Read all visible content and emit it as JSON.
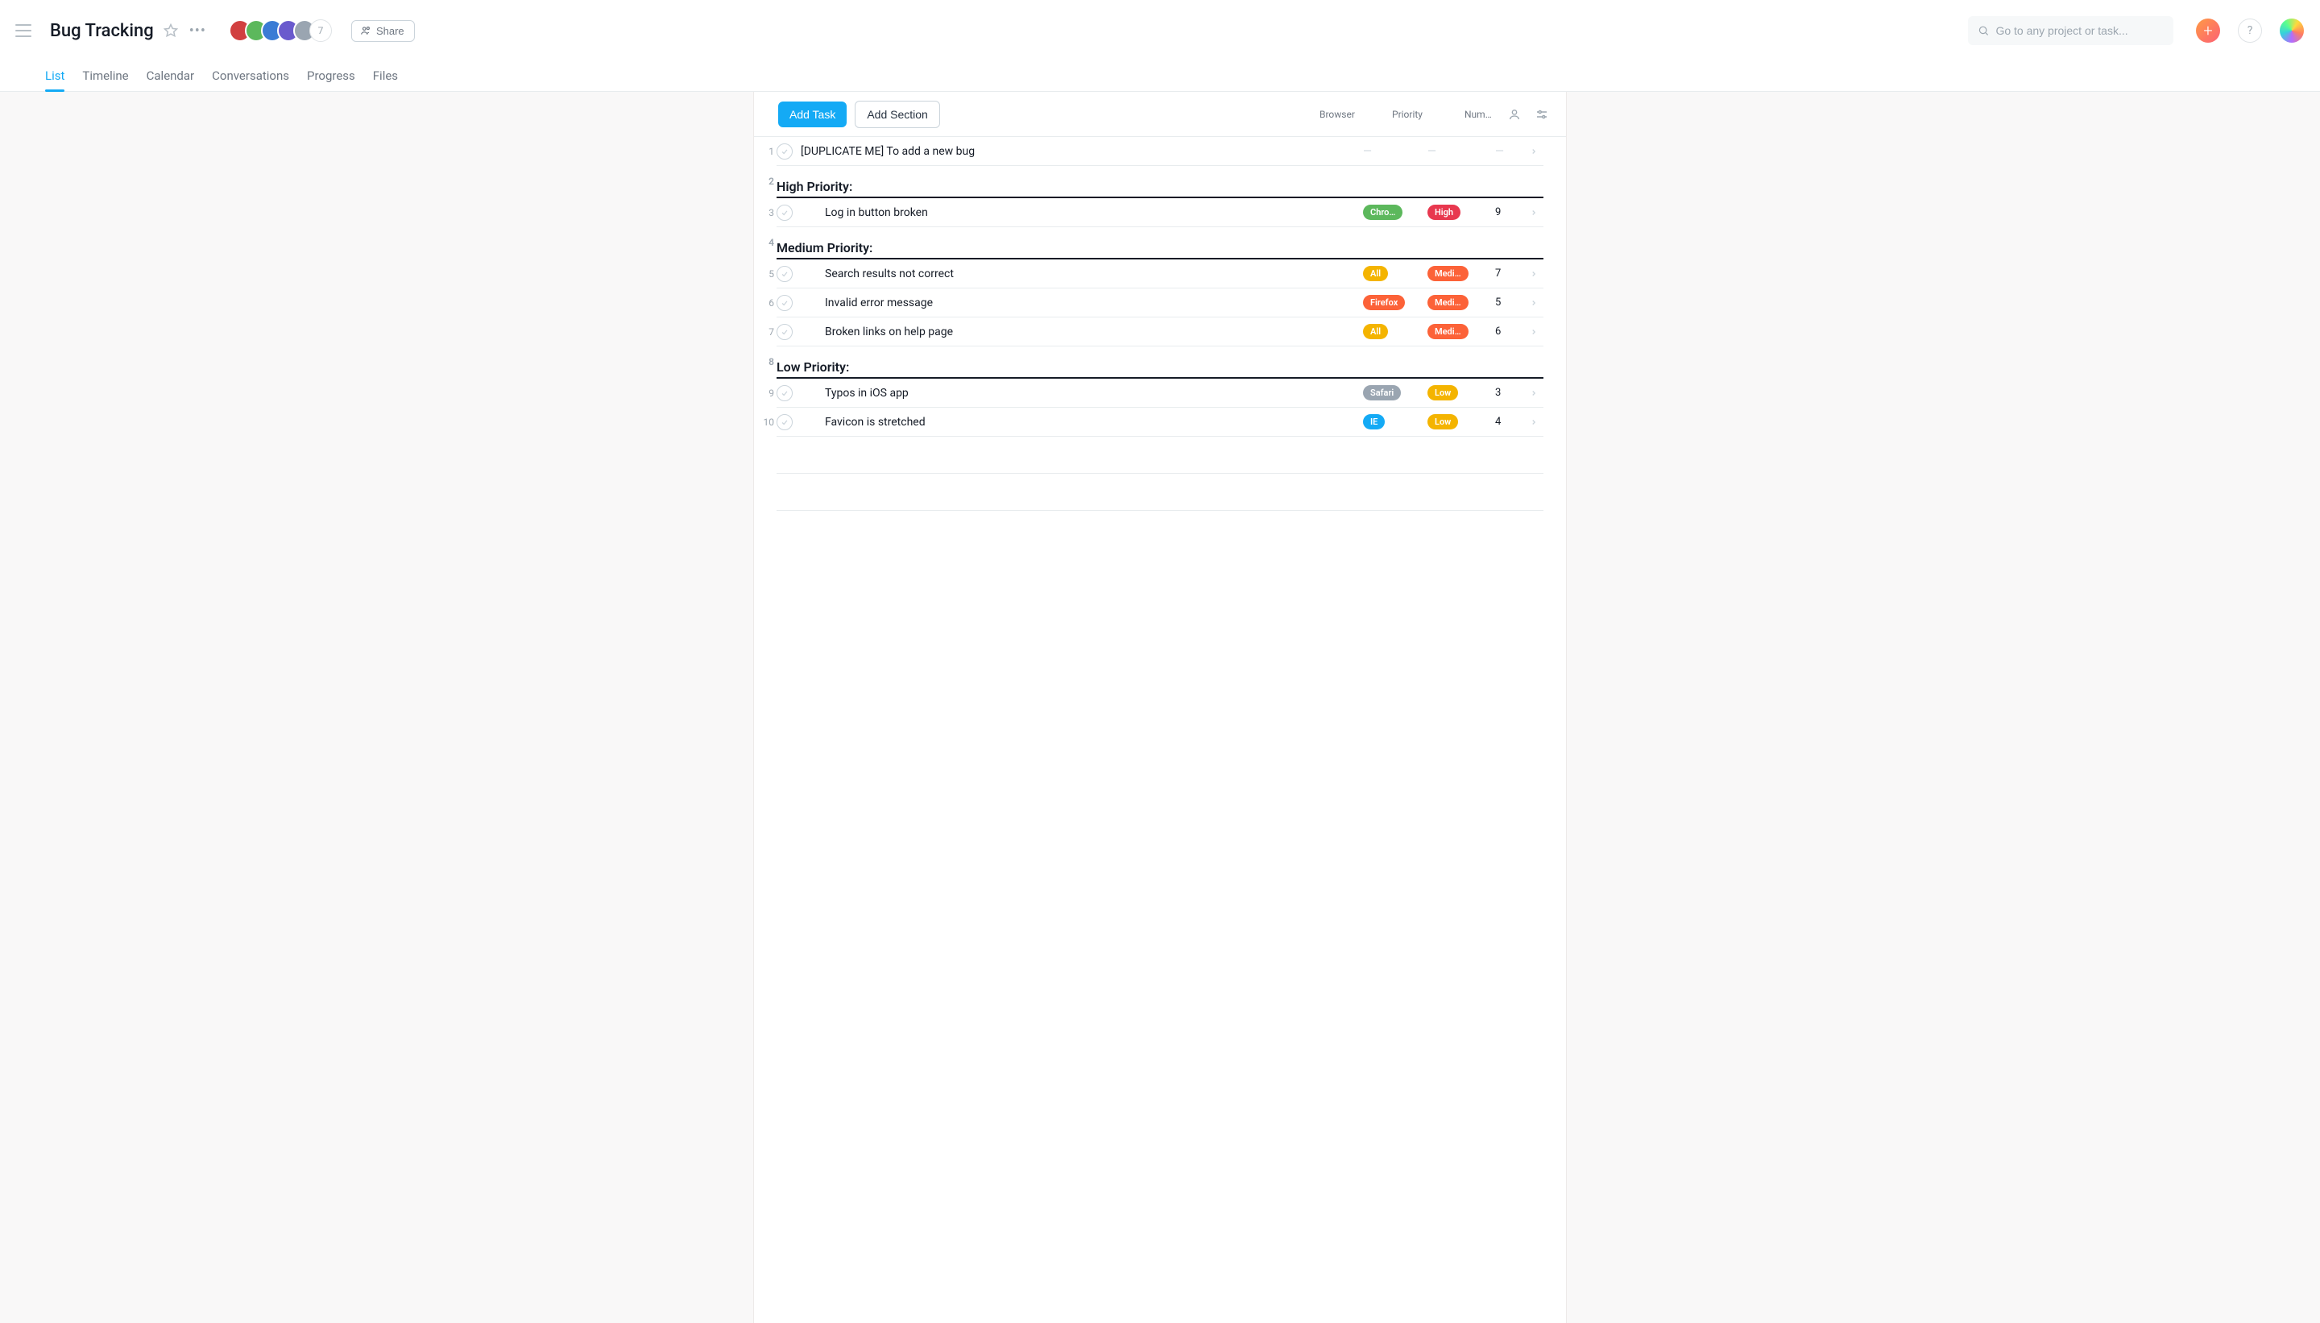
{
  "header": {
    "title": "Bug Tracking",
    "member_count": "7",
    "share_label": "Share",
    "members": [
      {
        "color": "#d14040"
      },
      {
        "color": "#5cb85c"
      },
      {
        "color": "#3a7bd5"
      },
      {
        "color": "#6a5acd"
      },
      {
        "color": "#9aa5b1"
      }
    ]
  },
  "search": {
    "placeholder": "Go to any project or task..."
  },
  "tabs": [
    {
      "label": "List",
      "active": true
    },
    {
      "label": "Timeline"
    },
    {
      "label": "Calendar"
    },
    {
      "label": "Conversations"
    },
    {
      "label": "Progress"
    },
    {
      "label": "Files"
    }
  ],
  "toolbar": {
    "add_task_label": "Add Task",
    "add_section_label": "Add Section",
    "columns": [
      "Browser",
      "Priority",
      "Num…"
    ]
  },
  "pill_colors": {
    "Chro…": "#5cb85c",
    "High": "#e8384f",
    "All": "#f4b400",
    "Medi…": "#fc6238",
    "Firefox": "#fc6238",
    "Safari": "#9aa5b1",
    "Low": "#f4b400",
    "IE": "#14aaf5"
  },
  "rows": [
    {
      "n": "1",
      "type": "task",
      "title": "[DUPLICATE ME] To add a new bug",
      "browser": "",
      "priority": "",
      "num": "",
      "dash": true
    },
    {
      "n": "2",
      "type": "section",
      "title": "High Priority:"
    },
    {
      "n": "3",
      "type": "task",
      "title": "Log in button broken",
      "browser": "Chro…",
      "priority": "High",
      "num": "9",
      "indent": true
    },
    {
      "n": "4",
      "type": "section",
      "title": "Medium Priority:"
    },
    {
      "n": "5",
      "type": "task",
      "title": "Search results not correct",
      "browser": "All",
      "priority": "Medi…",
      "num": "7",
      "indent": true
    },
    {
      "n": "6",
      "type": "task",
      "title": "Invalid error message",
      "browser": "Firefox",
      "priority": "Medi…",
      "num": "5",
      "indent": true
    },
    {
      "n": "7",
      "type": "task",
      "title": "Broken links on help page",
      "browser": "All",
      "priority": "Medi…",
      "num": "6",
      "indent": true
    },
    {
      "n": "8",
      "type": "section",
      "title": "Low Priority:"
    },
    {
      "n": "9",
      "type": "task",
      "title": "Typos in iOS app",
      "browser": "Safari",
      "priority": "Low",
      "num": "3",
      "indent": true
    },
    {
      "n": "10",
      "type": "task",
      "title": "Favicon is stretched",
      "browser": "IE",
      "priority": "Low",
      "num": "4",
      "indent": true
    }
  ]
}
